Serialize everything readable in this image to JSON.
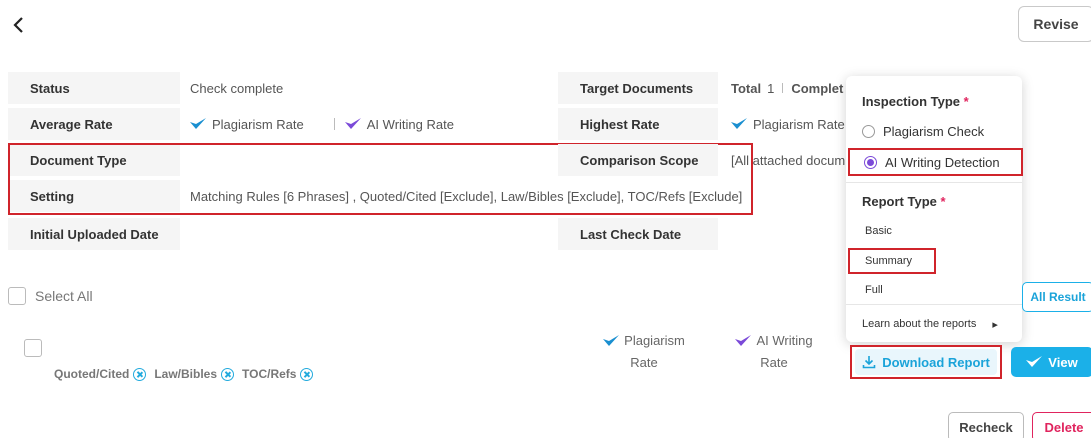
{
  "header": {
    "back_icon": "chevron-left-icon",
    "revise_label": "Revise"
  },
  "info": {
    "status_label": "Status",
    "status_value": "Check complete",
    "avg_rate_label": "Average Rate",
    "plag_rate": "Plagiarism Rate",
    "ai_rate": "AI Writing Rate",
    "doc_type_label": "Document Type",
    "doc_type_value": "",
    "setting_label": "Setting",
    "setting_value": "Matching Rules [6 Phrases] , Quoted/Cited [Exclude], Law/Bibles [Exclude], TOC/Refs [Exclude]",
    "uploaded_label": "Initial Uploaded Date",
    "uploaded_value": "",
    "target_label": "Target Documents",
    "target_total": "Total",
    "target_count": "1",
    "target_complete": "Complet",
    "highest_label": "Highest Rate",
    "highest_value": "Plagiarism Rate",
    "scope_label": "Comparison Scope",
    "scope_value": "[All attached docum",
    "last_check_label": "Last Check Date",
    "last_check_value": ""
  },
  "dropdown": {
    "inspection_title": "Inspection Type",
    "required_mark": "*",
    "option_plag": "Plagiarism Check",
    "option_ai": "AI Writing Detection",
    "report_title": "Report Type",
    "report_basic": "Basic",
    "report_summary": "Summary",
    "report_full": "Full",
    "learn_more": "Learn about the reports",
    "learn_arrow": "▸"
  },
  "list": {
    "select_all": "Select All",
    "all_result": "All Result",
    "tags": [
      "Quoted/Cited",
      "Law/Bibles",
      "TOC/Refs"
    ],
    "col_plag_line1": "Plagiarism",
    "col_plag_line2": "Rate",
    "col_ai_line1": "AI Writing",
    "col_ai_line2": "Rate",
    "download_label": "Download Report",
    "view_label": "View",
    "recheck_label": "Recheck",
    "delete_label": "Delete"
  },
  "colors": {
    "accent": "#1bb0e8",
    "ai_purple": "#7b4ad8",
    "highlight_red": "#d0242b",
    "delete_pink": "#e0245e"
  }
}
